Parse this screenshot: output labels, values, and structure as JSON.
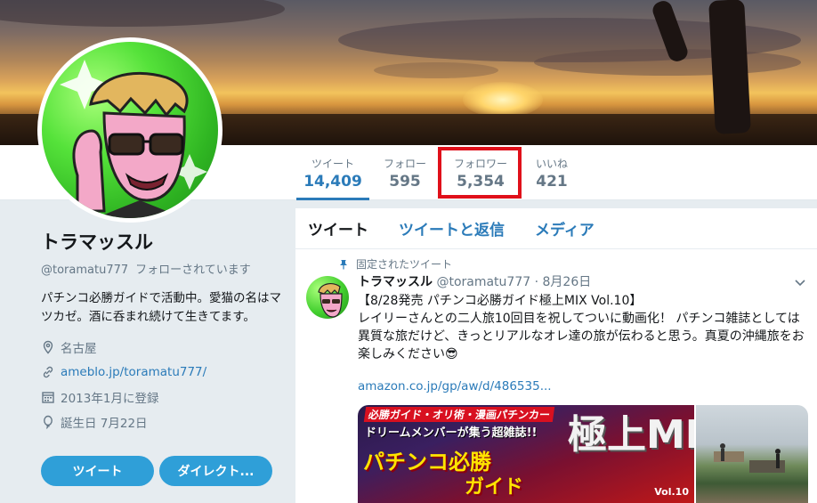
{
  "profile": {
    "name": "トラマッスル",
    "handle": "@toramatu777",
    "follows_you": "フォローされています",
    "bio": "パチンコ必勝ガイドで活動中。愛猫の名はマツカゼ。酒に呑まれ続けて生きてます。",
    "location": "名古屋",
    "url": "ameblo.jp/toramatu777/",
    "joined": "2013年1月に登録",
    "birthday": "誕生日 7月22日",
    "tweet_button": "ツイート",
    "dm_button": "ダイレクト..."
  },
  "stats": [
    {
      "label": "ツイート",
      "value": "14,409"
    },
    {
      "label": "フォロー",
      "value": "595"
    },
    {
      "label": "フォロワー",
      "value": "5,354"
    },
    {
      "label": "いいね",
      "value": "421"
    }
  ],
  "tabs": [
    "ツイート",
    "ツイートと返信",
    "メディア"
  ],
  "tweet": {
    "pinned": "固定されたツイート",
    "name": "トラマッスル",
    "handle": "@toramatu777",
    "date": "· 8月26日",
    "text_line1": "【8/28発売 パチンコ必勝ガイド極上MIX Vol.10】",
    "text_line2": "レイリーさんとの二人旅10回目を祝してついに動画化！ パチンコ雑誌としては異質な旅だけど、きっとリアルなオレ達の旅が伝わると思う。真夏の沖縄旅をお楽しみください😎",
    "link": "amazon.co.jp/gp/aw/d/486535...",
    "media_text_top": "必勝ガイド・オリ術・漫画パチンカー",
    "media_text_mid": "ドリームメンバーが集う超雑誌!!",
    "media_text_big1": "パチンコ必勝",
    "media_text_big2": "ガイド",
    "media_text_mix": "極上MIX",
    "media_text_vol": "Vol.10"
  },
  "colors": {
    "accent": "#2b7bb9",
    "button": "#2f9fd8",
    "highlight": "#e0101a"
  }
}
